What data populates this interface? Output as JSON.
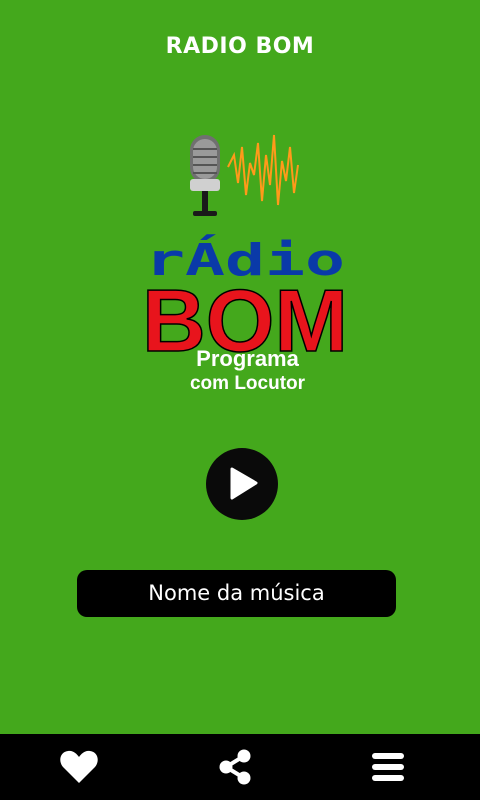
{
  "app": {
    "title": "RADIO BOM"
  },
  "logo": {
    "word_top": "rÁdio",
    "word_main": "BOM",
    "top_color": "#0a3aa8",
    "main_color": "#e8141c"
  },
  "program": {
    "name": "Programa",
    "host": "com Locutor"
  },
  "player": {
    "state": "paused",
    "play_icon": "play-icon",
    "song_title": "Nome da música"
  },
  "bottom_nav": {
    "items": [
      {
        "icon": "heart-icon"
      },
      {
        "icon": "share-icon"
      },
      {
        "icon": "menu-icon"
      }
    ]
  },
  "colors": {
    "background": "#44a81c",
    "bars": "#000000",
    "text": "#ffffff"
  }
}
